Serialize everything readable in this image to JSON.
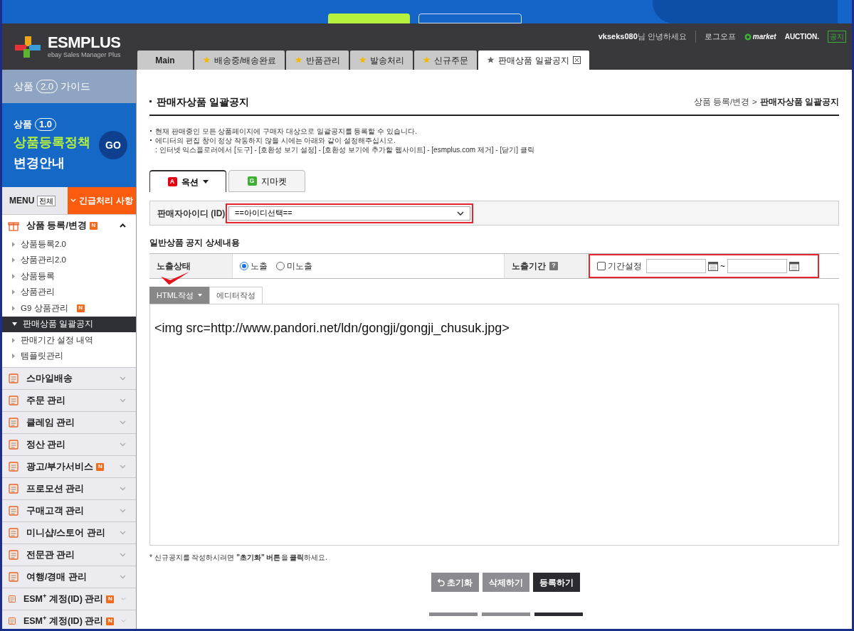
{
  "header": {
    "logo": {
      "name": "ESMPLUS",
      "tagline": "ebay Sales Manager Plus"
    },
    "user": "vkseks080",
    "greeting": "님 안녕하세요",
    "logout": "로그오프",
    "markets": [
      {
        "kind": "gmarket",
        "label": "market"
      },
      {
        "kind": "auction",
        "label": "AUCTION."
      }
    ],
    "notice_badge": "공지"
  },
  "tabs": [
    {
      "label": "Main",
      "star": false,
      "closable": false,
      "selected": false
    },
    {
      "label": "배송중/배송완료",
      "star": true,
      "closable": false,
      "selected": false
    },
    {
      "label": "반품관리",
      "star": true,
      "closable": false,
      "selected": false
    },
    {
      "label": "발송처리",
      "star": true,
      "closable": false,
      "selected": false
    },
    {
      "label": "신규주문",
      "star": true,
      "closable": false,
      "selected": false
    },
    {
      "label": "판매상품 일괄공지",
      "star": true,
      "closable": true,
      "selected": true
    }
  ],
  "sidebar": {
    "guide": {
      "prefix": "상품",
      "version": "2.0",
      "suffix": "가이드"
    },
    "promo": {
      "prefix": "상품",
      "version": "1.0",
      "title": "상품등록정책",
      "subtitle": "변경안내",
      "go": "GO"
    },
    "menu": {
      "label": "MENU",
      "all": "전체",
      "urgent": "긴급처리 사항"
    },
    "groups": [
      {
        "label": "상품 등록/변경",
        "badge": "N",
        "expanded": true,
        "children": [
          {
            "label": "상품등록2.0",
            "selected": false
          },
          {
            "label": "상품관리2.0",
            "selected": false
          },
          {
            "label": "상품등록",
            "selected": false
          },
          {
            "label": "상품관리",
            "selected": false
          },
          {
            "label": "G9 상품관리",
            "badge": "N",
            "selected": false
          },
          {
            "label": "판매상품 일괄공지",
            "selected": true
          },
          {
            "label": "판매기간 설정 내역",
            "selected": false
          },
          {
            "label": "템플릿관리",
            "selected": false
          }
        ]
      },
      {
        "label": "스마일배송",
        "expanded": false
      },
      {
        "label": "주문 관리",
        "expanded": false
      },
      {
        "label": "클레임 관리",
        "expanded": false
      },
      {
        "label": "정산 관리",
        "expanded": false
      },
      {
        "label": "광고/부가서비스",
        "badge": "N",
        "expanded": false
      },
      {
        "label": "프로모션 관리",
        "expanded": false
      },
      {
        "label": "구매고객 관리",
        "expanded": false
      },
      {
        "label": "미니샵/스토어 관리",
        "expanded": false
      },
      {
        "label": "전문관 관리",
        "expanded": false
      },
      {
        "label": "여행/경매 관리",
        "expanded": false
      },
      {
        "label": "ESM$^{+}$ 계정(ID) 관리",
        "badge": "N",
        "expanded": false
      },
      {
        "label": "ESM$^{+}$ 계정(ID) 관리",
        "badge": "N",
        "expanded": false
      }
    ]
  },
  "content": {
    "title": "판매자상품 일괄공지",
    "breadcrumb": [
      {
        "label": "상품 등록/변경",
        "current": false
      },
      {
        "label": "판매자상품 일괄공지",
        "current": true
      }
    ],
    "breadcrumb_separator": ">",
    "notices": [
      {
        "kind": "bullet",
        "text": "현재 판매중인 모든 상품페이지에 구매자 대상으로 일괄공지를 등록할 수 있습니다."
      },
      {
        "kind": "bullet",
        "text": "에디터의 편집 창이 정상 작동하지 않을 시에는 아래와 같이 설정해주십시오."
      },
      {
        "kind": "sub",
        "text": ": 인터넷 익스플로러에서 [도구] - [호환성 보기 설정] - [호환성 보기에 추가할 웹사이트] - [esmplus.com 제거] - [닫기] 클릭"
      }
    ],
    "market_tabs": [
      {
        "badge": "A",
        "label": "옥션",
        "color": "#e60012",
        "dropdown": true,
        "selected": true
      },
      {
        "badge": "G",
        "label": "지마켓",
        "color": "#3cb034",
        "dropdown": false,
        "selected": false
      }
    ],
    "seller_id": {
      "label": "판매자아이디 (ID)",
      "value": "==아이디선택=="
    },
    "section_title": "일반상품 공지 상세내용",
    "exposure": {
      "label": "노출상태",
      "options": [
        {
          "label": "노출",
          "selected": true
        },
        {
          "label": "미노출",
          "selected": false
        }
      ],
      "period_label": "노출기간",
      "help": "?",
      "period_checkbox": {
        "label": "기간설정",
        "checked": false
      },
      "separator": "~"
    },
    "editor_tabs": [
      {
        "label": "HTML작성",
        "selected": true
      },
      {
        "label": "에디터작성",
        "selected": false
      }
    ],
    "editor_text": "<img src=http://www.pandori.net/ldn/gongji/gongji_chusuk.jpg>",
    "note": "* 신규공지를 작성하시려면 **\"초기화\" 버튼**을 **클릭**하세요.",
    "buttons": [
      {
        "kind": "reset",
        "label": "초기화"
      },
      {
        "kind": "delete",
        "label": "삭제하기"
      },
      {
        "kind": "submit",
        "label": "등록하기"
      }
    ]
  }
}
